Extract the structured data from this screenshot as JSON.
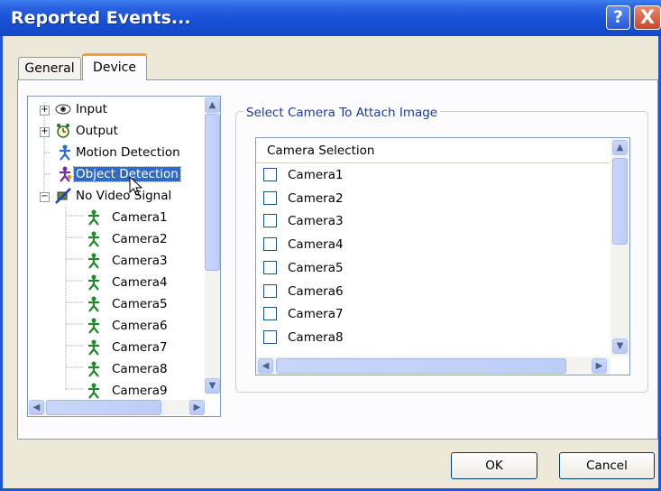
{
  "window": {
    "title": "Reported Events..."
  },
  "titlebar_buttons": {
    "help": "?",
    "close": "X"
  },
  "tabs": [
    {
      "label": "General"
    },
    {
      "label": "Device"
    }
  ],
  "tree": {
    "items": [
      {
        "label": "Input",
        "expander": "+",
        "icon": "eye-icon"
      },
      {
        "label": "Output",
        "expander": "+",
        "icon": "alarm-clock-icon"
      },
      {
        "label": "Motion Detection",
        "icon": "motion-person-icon"
      },
      {
        "label": "Object Detection",
        "icon": "object-person-icon",
        "selected": true
      },
      {
        "label": "No Video Signal",
        "expander": "−",
        "icon": "no-video-icon"
      }
    ],
    "children": [
      {
        "label": "Camera1"
      },
      {
        "label": "Camera2"
      },
      {
        "label": "Camera3"
      },
      {
        "label": "Camera4"
      },
      {
        "label": "Camera5"
      },
      {
        "label": "Camera6"
      },
      {
        "label": "Camera7"
      },
      {
        "label": "Camera8"
      },
      {
        "label": "Camera9"
      }
    ]
  },
  "group": {
    "legend": "Select Camera To Attach Image"
  },
  "camera_list": {
    "header": "Camera Selection",
    "items": [
      {
        "label": "Camera1",
        "checked": false
      },
      {
        "label": "Camera2",
        "checked": false
      },
      {
        "label": "Camera3",
        "checked": false
      },
      {
        "label": "Camera4",
        "checked": false
      },
      {
        "label": "Camera5",
        "checked": false
      },
      {
        "label": "Camera6",
        "checked": false
      },
      {
        "label": "Camera7",
        "checked": false
      },
      {
        "label": "Camera8",
        "checked": false
      }
    ]
  },
  "buttons": {
    "ok": "OK",
    "cancel": "Cancel"
  },
  "colors": {
    "titlebar": "#1851d6",
    "selection": "#316ac5",
    "motion_icon": "#2d6fd0",
    "object_icon": "#7a2aa0",
    "camera_icon": "#1e8a2a"
  }
}
